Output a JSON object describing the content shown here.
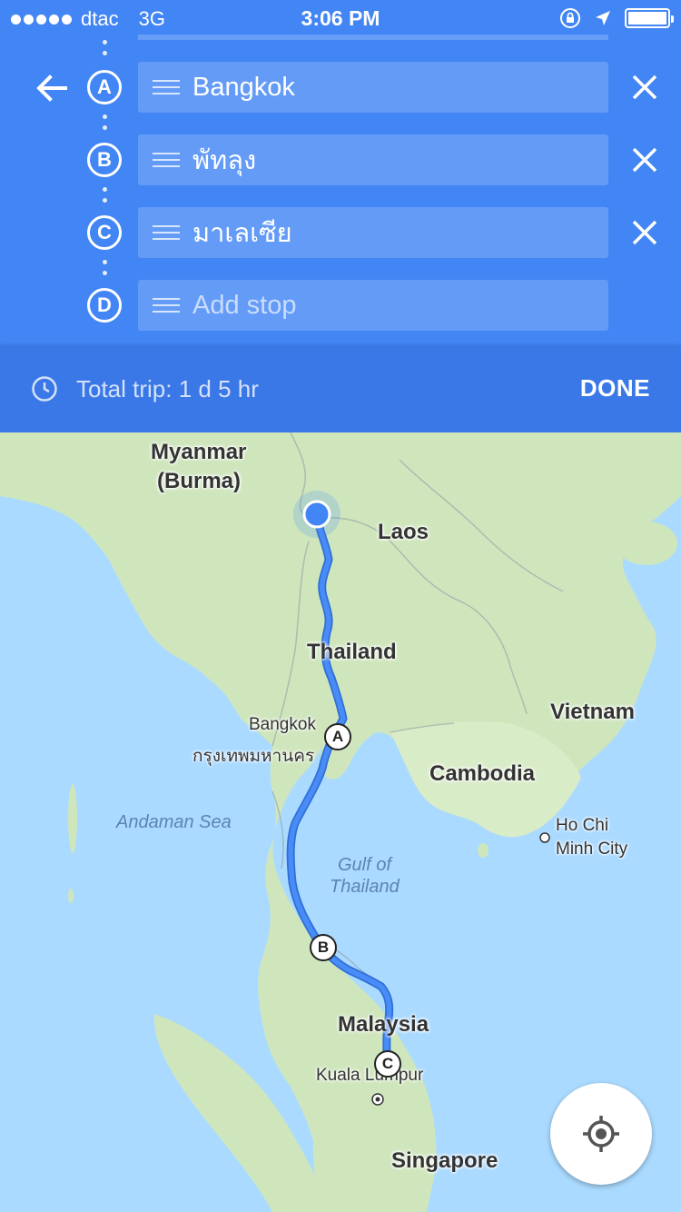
{
  "status_bar": {
    "carrier": "dtac",
    "network": "3G",
    "time": "3:06 PM",
    "battery_level": 1.0
  },
  "directions": {
    "stops": [
      {
        "letter": "A",
        "text": "Bangkok"
      },
      {
        "letter": "B",
        "text": "พัทลุง"
      },
      {
        "letter": "C",
        "text": "มาเลเซีย"
      }
    ],
    "add_stop": {
      "letter": "D",
      "placeholder": "Add stop"
    },
    "total_trip": "Total trip: 1 d 5 hr",
    "done_label": "DONE"
  },
  "map": {
    "labels": {
      "myanmar": "Myanmar",
      "burma": "(Burma)",
      "laos": "Laos",
      "thailand": "Thailand",
      "vietnam": "Vietnam",
      "bangkok": "Bangkok",
      "bangkok_thai": "กรุงเทพมหานคร",
      "cambodia": "Cambodia",
      "andaman_sea": "Andaman Sea",
      "gulf_line1": "Gulf of",
      "gulf_line2": "Thailand",
      "hcmc_line1": "Ho Chi",
      "hcmc_line2": "Minh City",
      "malaysia": "Malaysia",
      "kuala_lumpur": "Kuala Lumpur",
      "singapore": "Singapore"
    },
    "markers": [
      "A",
      "B",
      "C"
    ],
    "colors": {
      "water": "#aadaff",
      "land": "#cfe6bd",
      "route": "#4a8cf7",
      "route_edge": "#2f6fd6",
      "header_blue": "#4285f4"
    }
  }
}
